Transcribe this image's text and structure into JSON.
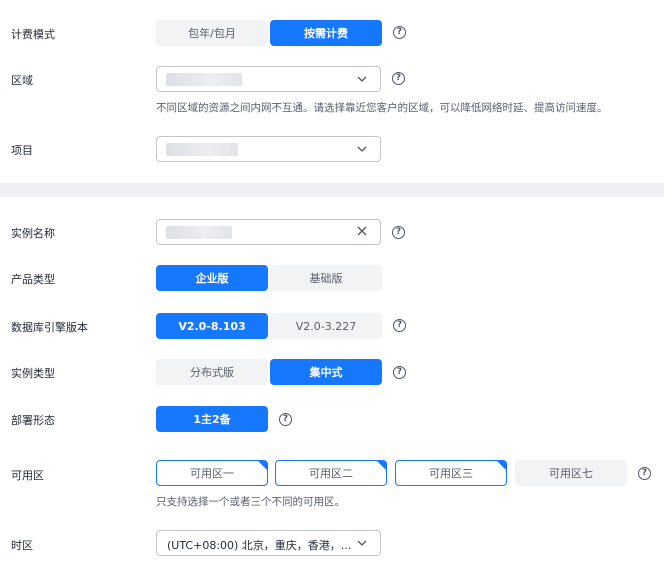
{
  "billing": {
    "label": "计费模式",
    "options": [
      "包年/包月",
      "按需计费"
    ],
    "selected": "按需计费"
  },
  "region": {
    "label": "区域",
    "value": "",
    "hint": "不同区域的资源之间内网不互通。请选择靠近您客户的区域，可以降低网络时延、提高访问速度。"
  },
  "project": {
    "label": "项目",
    "value": ""
  },
  "instance_name": {
    "label": "实例名称",
    "value": ""
  },
  "product_type": {
    "label": "产品类型",
    "options": [
      "企业版",
      "基础版"
    ],
    "selected": "企业版"
  },
  "engine_version": {
    "label": "数据库引擎版本",
    "options": [
      "V2.0-8.103",
      "V2.0-3.227"
    ],
    "selected": "V2.0-8.103"
  },
  "instance_type": {
    "label": "实例类型",
    "options": [
      "分布式版",
      "集中式"
    ],
    "selected": "集中式"
  },
  "deployment": {
    "label": "部署形态",
    "options": [
      "1主2备"
    ],
    "selected": "1主2备"
  },
  "az": {
    "label": "可用区",
    "options": [
      "可用区一",
      "可用区二",
      "可用区三",
      "可用区七"
    ],
    "selected": [
      "可用区一",
      "可用区二",
      "可用区三"
    ],
    "hint": "只支持选择一个或者三个不同的可用区。"
  },
  "timezone": {
    "label": "时区",
    "value": "(UTC+08:00) 北京，重庆，香港，..."
  },
  "help_glyph": "?",
  "colors": {
    "accent": "#1677ff",
    "segment_bg": "#f2f3f5",
    "divider": "#f0f0f4"
  }
}
